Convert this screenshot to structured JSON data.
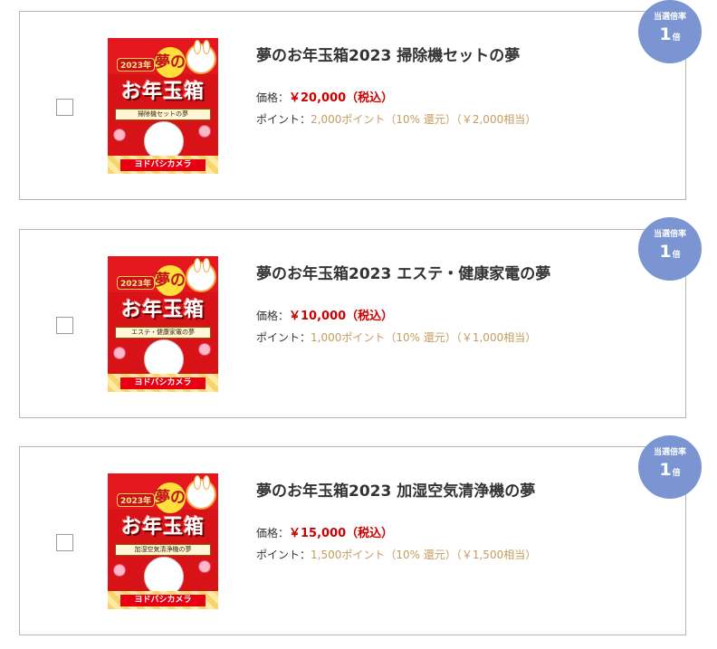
{
  "products": [
    {
      "title": "夢のお年玉箱2023 掃除機セットの夢",
      "price_label": "価格：",
      "price_value": "￥20,000（税込）",
      "points_label": "ポイント：",
      "points_value": "2,000ポイント（10% 還元）（￥2,000相当）",
      "image_ribbon": "掃除機セットの夢",
      "badge_label": "当選倍率",
      "badge_number": "1",
      "badge_unit": "倍"
    },
    {
      "title": "夢のお年玉箱2023 エステ・健康家電の夢",
      "price_label": "価格：",
      "price_value": "￥10,000（税込）",
      "points_label": "ポイント：",
      "points_value": "1,000ポイント（10% 還元）（￥1,000相当）",
      "image_ribbon": "エステ・健康家電の夢",
      "badge_label": "当選倍率",
      "badge_number": "1",
      "badge_unit": "倍"
    },
    {
      "title": "夢のお年玉箱2023 加湿空気清浄機の夢",
      "price_label": "価格：",
      "price_value": "￥15,000（税込）",
      "points_label": "ポイント：",
      "points_value": "1,500ポイント（10% 還元）（￥1,500相当）",
      "image_ribbon": "加湿空気清浄機の夢",
      "badge_label": "当選倍率",
      "badge_number": "1",
      "badge_unit": "倍"
    }
  ],
  "image_text": {
    "year": "2023年",
    "yume": "夢の",
    "main": "お年玉箱",
    "logo": "ヨドバシカメラ"
  },
  "colors": {
    "price": "#cc0000",
    "points": "#c69c5d",
    "badge": "#7a95d2",
    "border": "#b5b5b5"
  }
}
